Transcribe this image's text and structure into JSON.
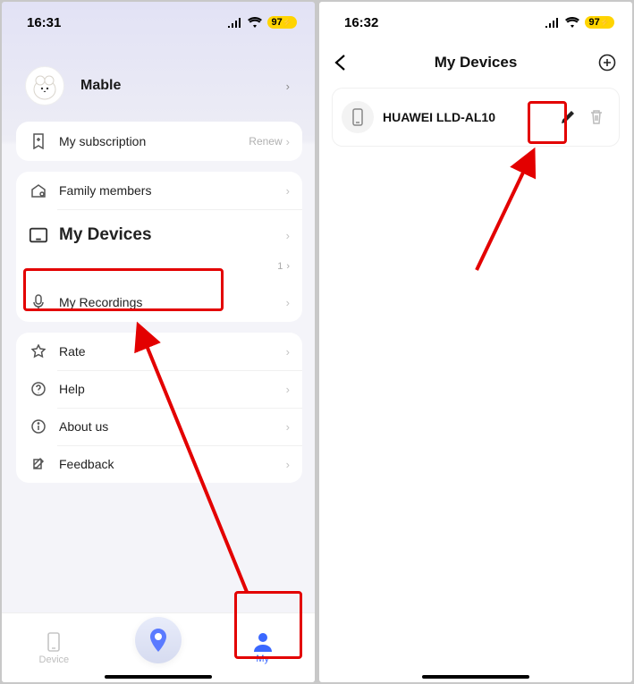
{
  "left": {
    "status": {
      "time": "16:31",
      "battery": "97"
    },
    "user": {
      "name": "Mable"
    },
    "menu": {
      "subscription": {
        "label": "My subscription",
        "action": "Renew"
      },
      "family": {
        "label": "Family members"
      },
      "devices": {
        "label": "My Devices",
        "count": "1"
      },
      "recordings": {
        "label": "My Recordings"
      },
      "rate": {
        "label": "Rate"
      },
      "help": {
        "label": "Help"
      },
      "about": {
        "label": "About us"
      },
      "feedback": {
        "label": "Feedback"
      }
    },
    "tabs": {
      "device": "Device",
      "my": "My"
    }
  },
  "right": {
    "status": {
      "time": "16:32",
      "battery": "97"
    },
    "title": "My Devices",
    "device": {
      "name": "HUAWEI LLD-AL10"
    }
  }
}
